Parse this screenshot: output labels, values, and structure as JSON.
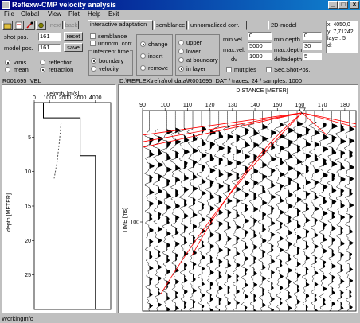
{
  "window": {
    "title": "Reflexw-CMP velocity analysis",
    "min_btn": "_",
    "max_btn": "□",
    "close_btn": "×"
  },
  "menu": [
    "File",
    "Global",
    "View",
    "Plot",
    "Help",
    "Exit"
  ],
  "toolbar": {
    "icons": [
      "open-icon",
      "print-icon",
      "tools-icon",
      "gear-icon"
    ],
    "next_label": "next",
    "back_label": "back"
  },
  "tabs": [
    "interactive adaptation",
    "semblance",
    "unnormalized corr.",
    "2D-model"
  ],
  "shot_pos": {
    "label": "shot pos.",
    "value": "161",
    "reset_label": "reset"
  },
  "model_pos": {
    "label": "model pos.",
    "value": "161",
    "save_label": "save"
  },
  "vrms": {
    "label": "vrms",
    "selected": true
  },
  "mean": {
    "label": "mean",
    "selected": false
  },
  "reflection": {
    "label": "reflection",
    "selected": false
  },
  "retraction": {
    "label": "retraction",
    "selected": true
  },
  "semblance_chk": {
    "label": "semblance",
    "checked": false
  },
  "unnorm_chk": {
    "label": "unnorm. corr.",
    "checked": false
  },
  "intercept": {
    "label": "intercept time",
    "boundary": "boundary",
    "velocity": "velocity"
  },
  "mode": {
    "change": "change",
    "insert": "insert",
    "remove": "remove"
  },
  "layer_pos": {
    "upper": "upper",
    "lower": "lower",
    "at_boundary": "at boundary",
    "in_layer": "in layer"
  },
  "vel_params": {
    "min_label": "min.vel.",
    "min_value": "0",
    "max_label": "max.vel.",
    "max_value": "5000",
    "dv_label": "dv",
    "dv_value": "1000"
  },
  "depth_params": {
    "min_label": "min.depth",
    "min_value": "0",
    "max_label": "max.depth",
    "max_value": "30",
    "delta_label": "deltadepth",
    "delta_value": "5"
  },
  "multiples": {
    "label": "mutiples",
    "checked": false
  },
  "sec_shot": {
    "label": "Sec.ShotPos.",
    "checked": false
  },
  "info": {
    "x": "x: 4050,0",
    "y": "y: 7,71242",
    "layer": "layer: 5",
    "d": "d:"
  },
  "left_panel": {
    "title": "R001695_VEL"
  },
  "right_panel": {
    "title": "D:\\REFLEX\\refra\\rohdata\\R001695_DAT / traces: 24 / samples: 1000"
  },
  "status_text": "WorkingInfo",
  "chart_data": [
    {
      "type": "line",
      "title": "",
      "xlabel": "velocity [m/s]",
      "ylabel": "depth [METER]",
      "xlim": [
        0,
        5000
      ],
      "ylim": [
        0,
        30
      ],
      "x_ticks": [
        0,
        1000,
        2000,
        3000,
        4000
      ],
      "y_ticks": [
        5,
        10,
        15,
        20,
        25
      ],
      "series": [
        {
          "style": "solid",
          "points": [
            [
              600,
              0
            ],
            [
              600,
              2.2
            ],
            [
              3000,
              2.2
            ],
            [
              3000,
              7.7
            ],
            [
              4000,
              7.7
            ],
            [
              4000,
              30
            ]
          ]
        },
        {
          "style": "dashed",
          "points": [
            [
              1750,
              3.0
            ],
            [
              1650,
              5.5
            ],
            [
              1500,
              8.5
            ],
            [
              1300,
              11
            ]
          ]
        }
      ]
    },
    {
      "type": "seismogram",
      "xlabel": "DISTANCE [METER]",
      "ylabel": "TIME [ms]",
      "xlim": [
        90,
        185
      ],
      "ylim": [
        0,
        180
      ],
      "x_ticks": [
        90,
        100,
        110,
        120,
        130,
        140,
        150,
        160,
        170,
        180
      ],
      "y_ticks": [
        100
      ],
      "traces": 24,
      "shot_position": 161,
      "overlay_color": "#ff0000"
    }
  ]
}
